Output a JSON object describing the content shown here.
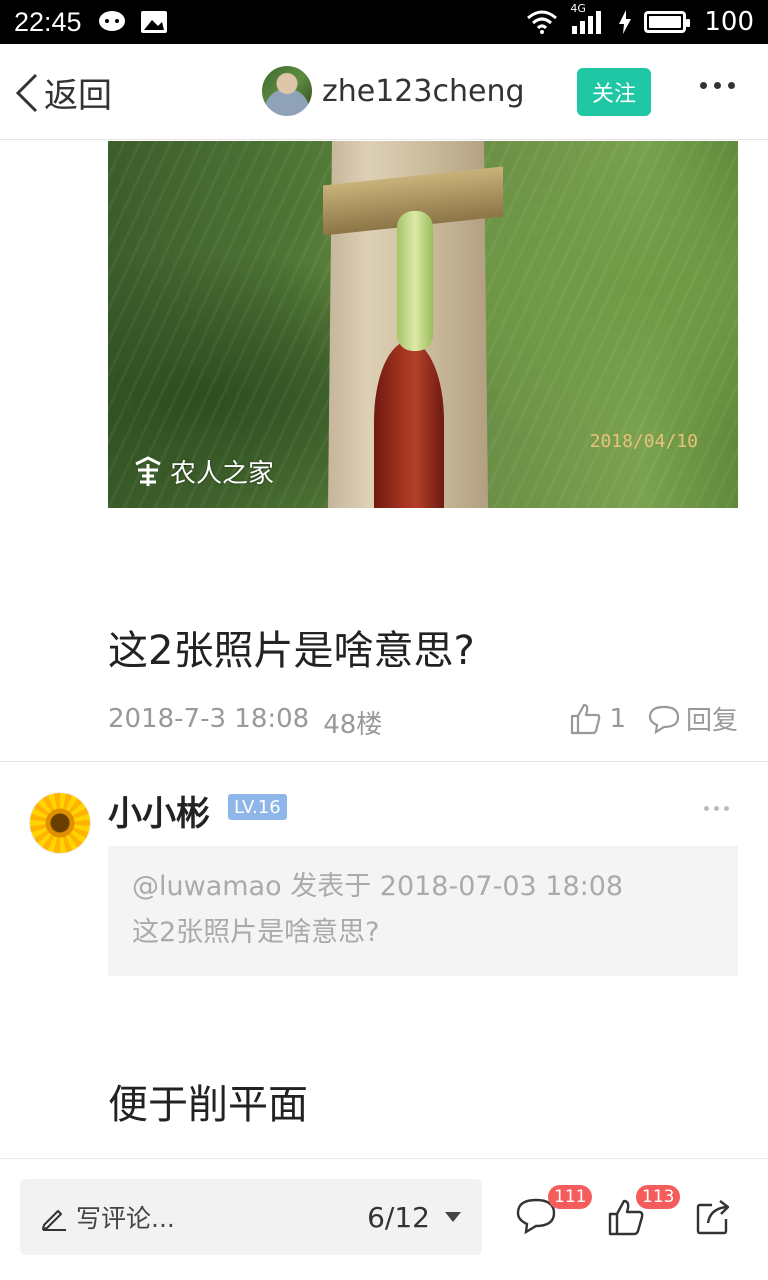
{
  "status_bar": {
    "time": "22:45",
    "network": "4G",
    "battery": "100"
  },
  "nav": {
    "back_label": "返回",
    "username": "zhe123cheng",
    "follow_label": "关注"
  },
  "photo": {
    "watermark": "农人之家",
    "date_stamp": "2018/04/10"
  },
  "post": {
    "text": "这2张照片是啥意思?",
    "datetime": "2018-7-3 18:08",
    "floor": "48楼",
    "like_count": "1",
    "reply_label": "回复"
  },
  "comment": {
    "author": "小小彬",
    "level": "LV.16",
    "quote_header": "@luwamao 发表于 2018-07-03 18:08",
    "quote_text": "这2张照片是啥意思?",
    "text": "便于削平面"
  },
  "bottom_bar": {
    "comment_placeholder": "写评论...",
    "page_indicator": "6/12",
    "comment_badge": "111",
    "like_badge": "113"
  },
  "colors": {
    "accent": "#1fc7a5",
    "badge": "#f55d5d",
    "level_badge": "#8fb6e8"
  }
}
